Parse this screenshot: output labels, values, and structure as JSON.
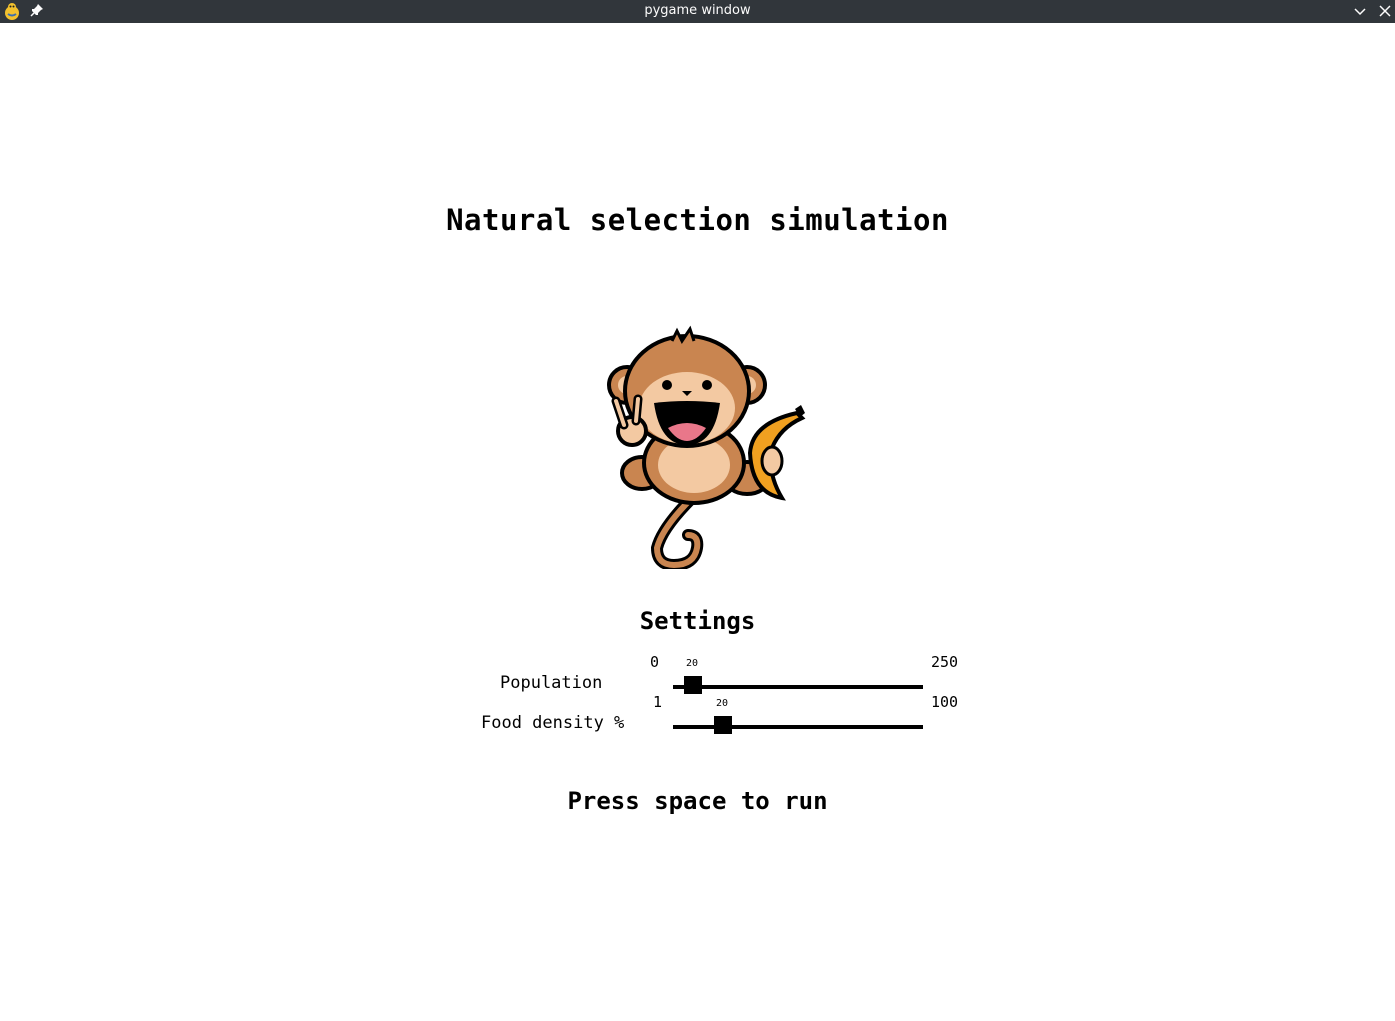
{
  "window": {
    "title": "pygame window",
    "app_icon": "pygame-snake-icon",
    "pin_icon": "pin-icon",
    "minimize_icon": "chevron-down-icon",
    "close_icon": "close-icon",
    "titlebar_color": "#31363b"
  },
  "main": {
    "title": "Natural selection simulation",
    "illustration": "monkey-holding-banana"
  },
  "settings": {
    "title": "Settings",
    "sliders": [
      {
        "label": "Population",
        "min": "0",
        "max": "250",
        "value": "20",
        "fraction": 0.08
      },
      {
        "label": "Food density %",
        "min": "1",
        "max": "100",
        "value": "20",
        "fraction": 0.2
      }
    ]
  },
  "footer": {
    "hint": "Press space to run"
  }
}
